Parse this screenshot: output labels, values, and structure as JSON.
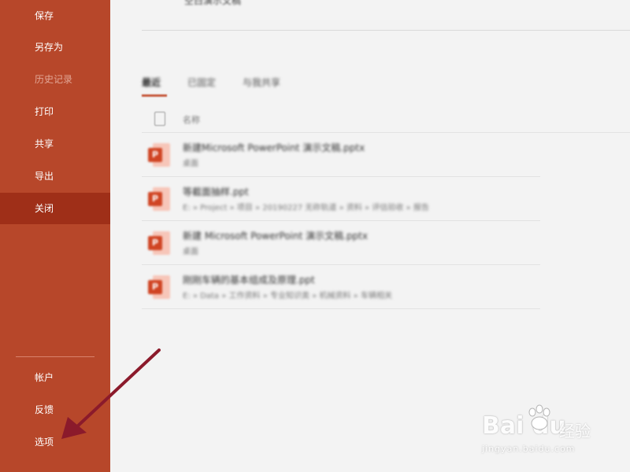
{
  "sidebar": {
    "items": [
      {
        "label": "保存"
      },
      {
        "label": "另存为"
      },
      {
        "label": "历史记录"
      },
      {
        "label": "打印"
      },
      {
        "label": "共享"
      },
      {
        "label": "导出"
      },
      {
        "label": "关闭"
      }
    ],
    "bottom_items": [
      {
        "label": "帐户"
      },
      {
        "label": "反馈"
      },
      {
        "label": "选项"
      }
    ]
  },
  "main": {
    "template_label": "空白演示文稿",
    "tabs": [
      {
        "label": "最近"
      },
      {
        "label": "已固定"
      },
      {
        "label": "与我共享"
      }
    ],
    "list_header": {
      "name_label": "名称"
    },
    "files": [
      {
        "name": "新建Microsoft PowerPoint 演示文稿.pptx",
        "path": "桌面"
      },
      {
        "name": "等截面抽样.ppt",
        "path": "E: » Project » 项目 » 20190227 无砟轨道 » 资料 » 评估验收 » 报告"
      },
      {
        "name": "新建 Microsoft PowerPoint 演示文稿.pptx",
        "path": "桌面"
      },
      {
        "name": "刚刚车辆的基本组成及原理.ppt",
        "path": "E: » Data » 工作资料 » 专业知识类 » 机械资料 » 车辆相关"
      }
    ]
  },
  "watermark": {
    "logo": "Bai du",
    "sub": "经验",
    "url": "jingyan.baidu.com"
  },
  "colors": {
    "sidebar_bg": "#b7472a",
    "sidebar_active": "#9f2f18",
    "accent": "#c65a3e",
    "arrow": "#8b1a2b"
  },
  "icons": {
    "file_icon": "powerpoint-file-icon",
    "header_icon": "document-icon",
    "annotation": "arrow-pointer-icon"
  }
}
